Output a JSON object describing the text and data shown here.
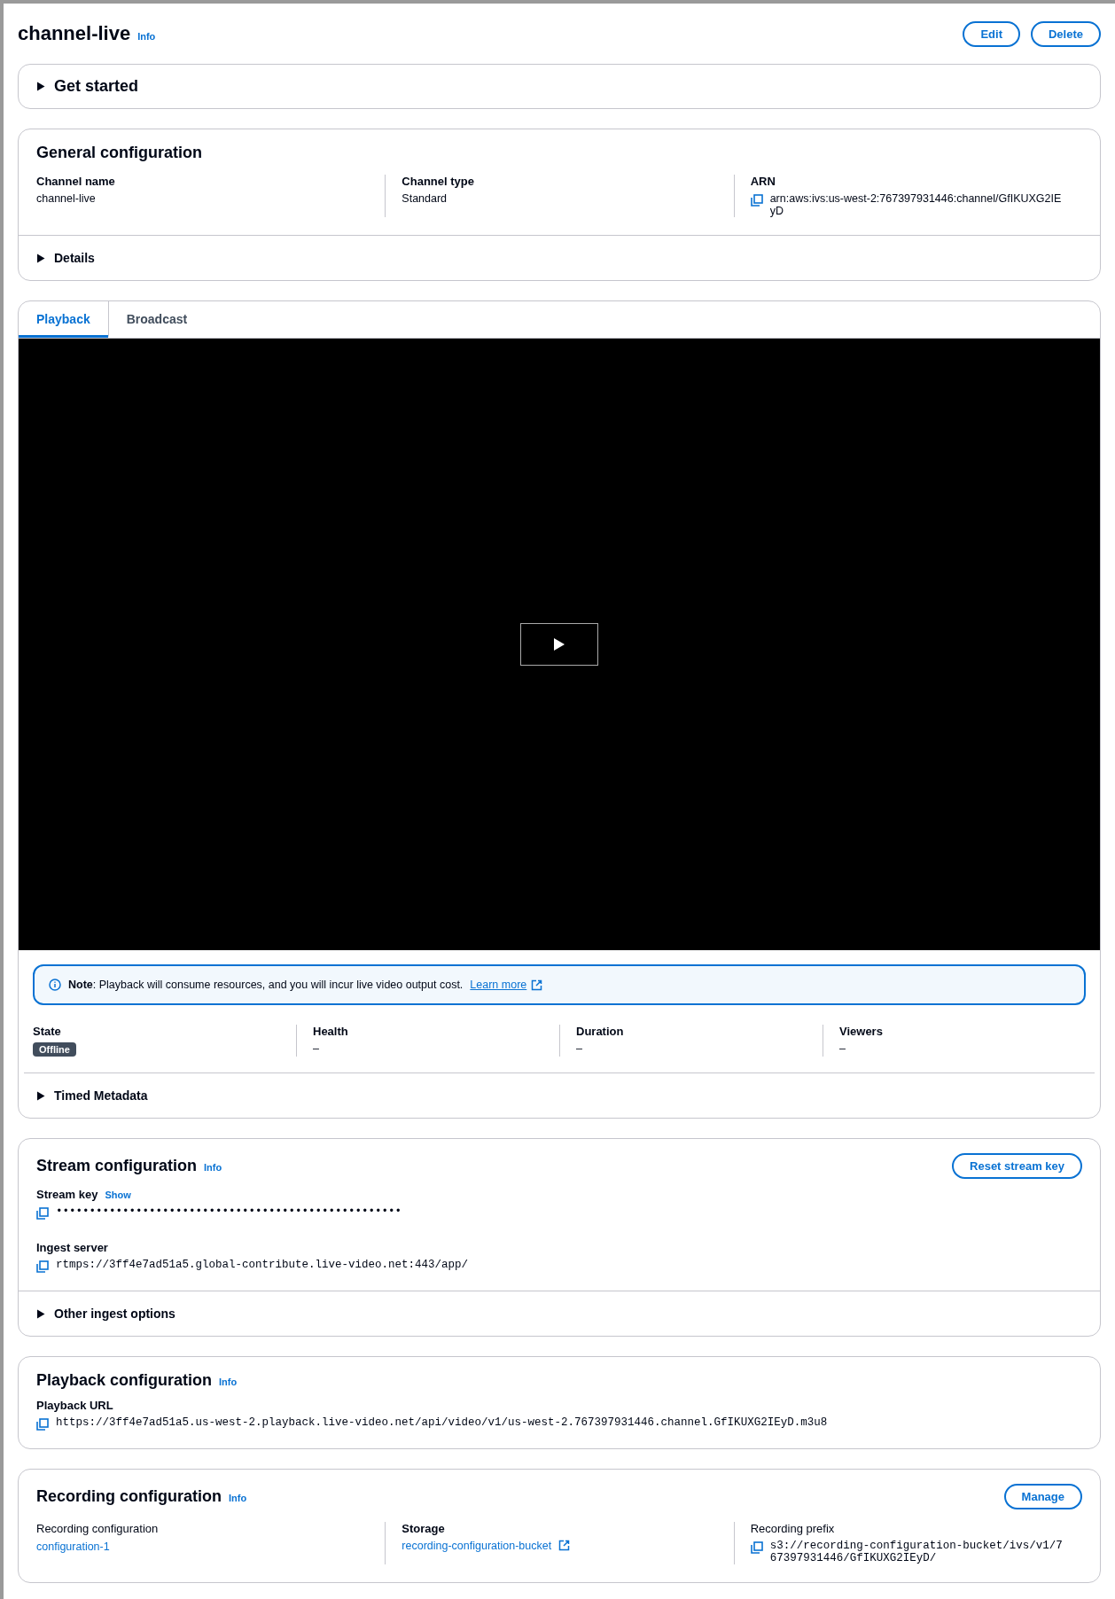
{
  "header": {
    "title": "channel-live",
    "info": "Info",
    "buttons": [
      "Edit",
      "Delete"
    ]
  },
  "get_started": {
    "label": "Get started",
    "expanded": false
  },
  "general_configuration": {
    "title": "General configuration",
    "fields": [
      {
        "label": "Channel name",
        "value": "channel-live",
        "kind": "text"
      },
      {
        "label": "Channel type",
        "value": "Standard",
        "kind": "text"
      },
      {
        "label": "ARN",
        "value": "arn:aws:ivs:us-west-2:767397931446:channel/GfIKUXG2IEyD",
        "kind": "copy"
      }
    ],
    "details": {
      "label": "Details",
      "expanded": false
    }
  },
  "playback_panel": {
    "tabs": [
      {
        "label": "Playback",
        "selected": true
      },
      {
        "label": "Broadcast",
        "selected": false
      }
    ],
    "note": {
      "text": "**Note**: Playback will consume resources, and you will incur live video output cost.",
      "link": "Learn more"
    },
    "stats": [
      {
        "label": "State",
        "value": "Offline",
        "kind": "badge"
      },
      {
        "label": "Health",
        "value": "–",
        "kind": "text"
      },
      {
        "label": "Duration",
        "value": "–",
        "kind": "text"
      },
      {
        "label": "Viewers",
        "value": "–",
        "kind": "text"
      }
    ],
    "timed_metadata": {
      "label": "Timed Metadata",
      "expanded": false
    }
  },
  "stream_configuration": {
    "title": "Stream configuration",
    "info": "Info",
    "button": "Reset stream key",
    "fields": [
      {
        "label": "Stream key",
        "action": "Show",
        "value": "••••••••••••••••••••••••••••••••••••••••••••••••••••",
        "kind": "code"
      },
      {
        "label": "Ingest server",
        "value": "rtmps://3ff4e7ad51a5.global-contribute.live-video.net:443/app/",
        "kind": "code"
      }
    ],
    "other": {
      "label": "Other ingest options",
      "expanded": false
    }
  },
  "playback_configuration": {
    "title": "Playback configuration",
    "info": "Info",
    "fields": [
      {
        "label": "Playback URL",
        "value": "https://3ff4e7ad51a5.us-west-2.playback.live-video.net/api/video/v1/us-west-2.767397931446.channel.GfIKUXG2IEyD.m3u8",
        "kind": "code"
      }
    ]
  },
  "recording_configuration": {
    "title": "Recording configuration",
    "info": "Info",
    "button": "Manage",
    "fields": [
      {
        "label": "Recording configuration",
        "value": "configuration-1",
        "kind": "link",
        "plain_label": true
      },
      {
        "label": "Storage",
        "value": "recording-configuration-bucket",
        "kind": "external"
      },
      {
        "label": "Recording prefix",
        "value": "s3://recording-configuration-bucket/ivs/v1/767397931446/GfIKUXG2IEyD/",
        "kind": "code",
        "plain_label": true
      }
    ]
  }
}
